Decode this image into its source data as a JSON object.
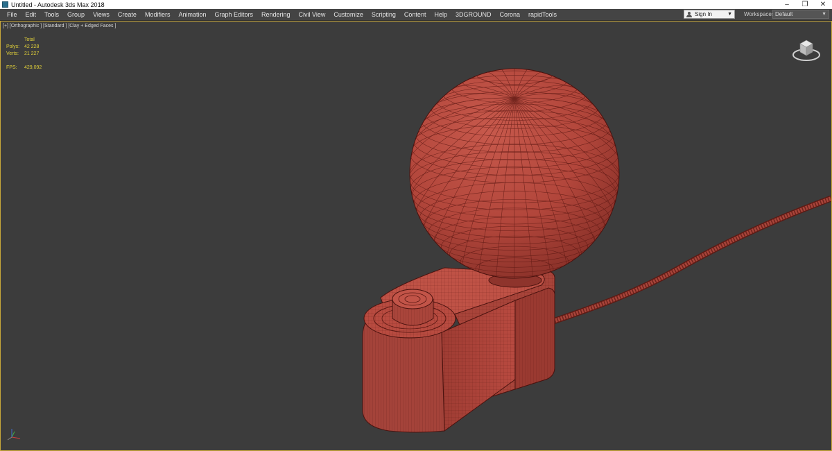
{
  "window": {
    "title": "Untitled - Autodesk 3ds Max 2018",
    "controls": {
      "minimize": "–",
      "restore": "❐",
      "close": "✕"
    }
  },
  "menu": {
    "items": [
      "File",
      "Edit",
      "Tools",
      "Group",
      "Views",
      "Create",
      "Modifiers",
      "Animation",
      "Graph Editors",
      "Rendering",
      "Civil View",
      "Customize",
      "Scripting",
      "Content",
      "Help",
      "3DGROUND",
      "Corona",
      "rapidTools"
    ]
  },
  "account": {
    "sign_in_label": "Sign In",
    "dropdown_icon": "chevron-down-icon"
  },
  "workspaces": {
    "label": "Workspaces:",
    "value": "Default"
  },
  "viewport": {
    "label": "[+] [Orthographic ] [Standard ] [Clay + Edged Faces ]",
    "stats": {
      "header": "Total",
      "polys_label": "Polys:",
      "polys_value": "42 228",
      "verts_label": "Verts:",
      "verts_value": "21 227",
      "fps_label": "FPS:",
      "fps_value": "429,092"
    },
    "border_color": "#c9a93a",
    "model_color": "#b4483e"
  }
}
